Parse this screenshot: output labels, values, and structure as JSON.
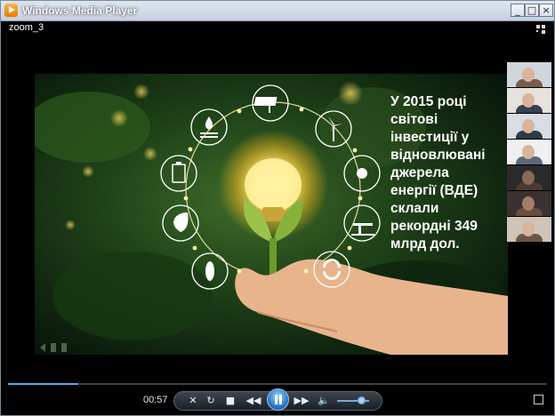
{
  "window": {
    "title": "Windows Media Player",
    "minimize_glyph": "_",
    "maximize_glyph": "□",
    "close_glyph": "×"
  },
  "now_playing": {
    "clip_name": "zoom_3"
  },
  "slide": {
    "lines": [
      "У 2015 році",
      "світові",
      "інвестиції у",
      "відновлювані",
      "джерела",
      "енергії (ВДЕ)",
      "склали",
      "рекордні 349",
      "млрд дол."
    ]
  },
  "playback": {
    "elapsed": "00:57",
    "progress_fraction": 0.13,
    "volume_fraction": 0.75,
    "state": "playing"
  },
  "controls": {
    "shuffle_icon": "shuffle-icon",
    "repeat_icon": "repeat-icon",
    "stop_icon": "stop-icon",
    "previous_icon": "previous-icon",
    "pause_icon": "pause-icon",
    "next_icon": "next-icon",
    "volume_icon": "speaker-icon"
  },
  "colors": {
    "accent": "#2a7cc9",
    "seek_fill": "#5aa3e8",
    "background": "#000000"
  }
}
